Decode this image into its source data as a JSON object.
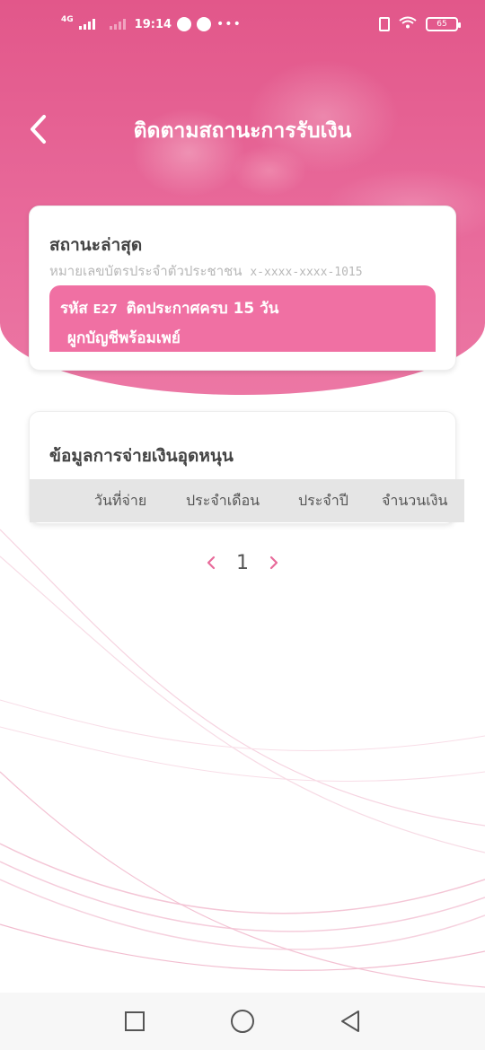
{
  "status_bar": {
    "network": "4G",
    "time": "19:14",
    "more": "•••",
    "battery": "65"
  },
  "header": {
    "title": "ติดตามสถานะการรับเงิน"
  },
  "status_card": {
    "heading": "สถานะล่าสุด",
    "id_label": "หมายเลขบัตรประจำตัวประชาชน",
    "id_value": "x-xxxx-xxxx-1015",
    "banner_code_label": "รหัส",
    "banner_code": "E27",
    "banner_text1": "ติดประกาศครบ 15 วัน",
    "banner_text2": "ผูกบัญชีพร้อมเพย์",
    "banner_color": "#f070a3"
  },
  "payment_card": {
    "heading": "ข้อมูลการจ่ายเงินอุดหนุน",
    "columns": [
      "วันที่จ่าย",
      "ประจำเดือน",
      "ประจำปี",
      "จำนวนเงิน"
    ]
  },
  "pagination": {
    "current_page": "1"
  },
  "colors": {
    "header_pink": "#e2578a",
    "accent_pink": "#f070a3",
    "pager_arrow": "#e86b9a"
  }
}
